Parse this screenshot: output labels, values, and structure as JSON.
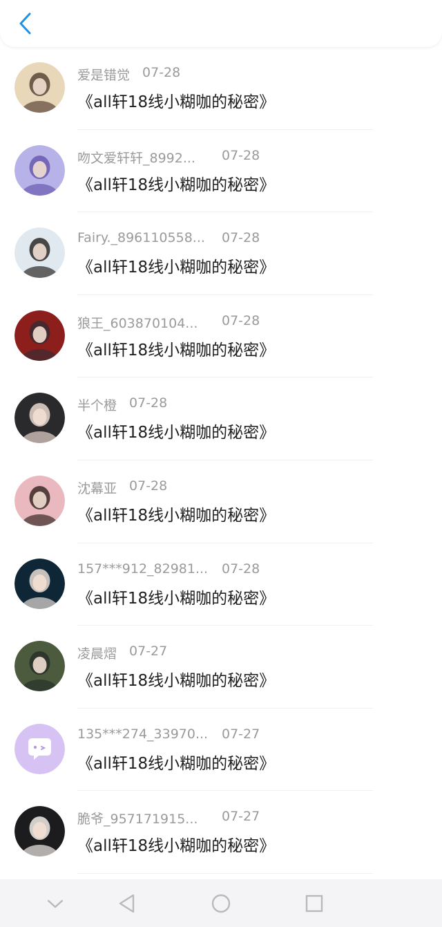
{
  "header": {
    "back_icon": "chevron-left-icon",
    "accent_color": "#1e90e6"
  },
  "items": [
    {
      "name": "爱是错觉",
      "date": "07-28",
      "title": "《all轩18线小糊咖的秘密》",
      "avatar_colors": [
        "#e9d7b9",
        "#5a4636"
      ]
    },
    {
      "name": "吻文爱轩轩_8992...",
      "date": "07-28",
      "title": "《all轩18线小糊咖的秘密》",
      "avatar_colors": [
        "#b7b3e8",
        "#6a5ab0"
      ]
    },
    {
      "name": "Fairy._896110558...",
      "date": "07-28",
      "title": "《all轩18线小糊咖的秘密》",
      "avatar_colors": [
        "#dfe9ef",
        "#2d2a2a"
      ]
    },
    {
      "name": "狼王_603870104...",
      "date": "07-28",
      "title": "《all轩18线小糊咖的秘密》",
      "avatar_colors": [
        "#8c1f1c",
        "#3a2b33"
      ]
    },
    {
      "name": "半个橙",
      "date": "07-28",
      "title": "《all轩18线小糊咖的秘密》",
      "avatar_colors": [
        "#2a2a2c",
        "#e8d6cc"
      ]
    },
    {
      "name": "沈幕亚",
      "date": "07-28",
      "title": "《all轩18线小糊咖的秘密》",
      "avatar_colors": [
        "#e9b9bf",
        "#3b2a26"
      ]
    },
    {
      "name": "157***912_82981...",
      "date": "07-28",
      "title": "《all轩18线小糊咖的秘密》",
      "avatar_colors": [
        "#0f2636",
        "#e7ddd6"
      ]
    },
    {
      "name": "凌晨熠",
      "date": "07-27",
      "title": "《all轩18线小糊咖的秘密》",
      "avatar_colors": [
        "#4c5a3e",
        "#27302a"
      ]
    },
    {
      "name": "135***274_33970...",
      "date": "07-27",
      "title": "《all轩18线小糊咖的秘密》",
      "avatar_colors": [
        "#d7c3f3",
        "#ffffff"
      ],
      "default_avatar": true
    },
    {
      "name": "脆爷_957171915...",
      "date": "07-27",
      "title": "《all轩18线小糊咖的秘密》",
      "avatar_colors": [
        "#1c1c1f",
        "#f1ece8"
      ]
    }
  ],
  "navbar": {
    "icons": [
      "chevron-down-icon",
      "back-triangle-icon",
      "home-circle-icon",
      "recents-square-icon"
    ],
    "icon_color": "#b9b9bd"
  }
}
